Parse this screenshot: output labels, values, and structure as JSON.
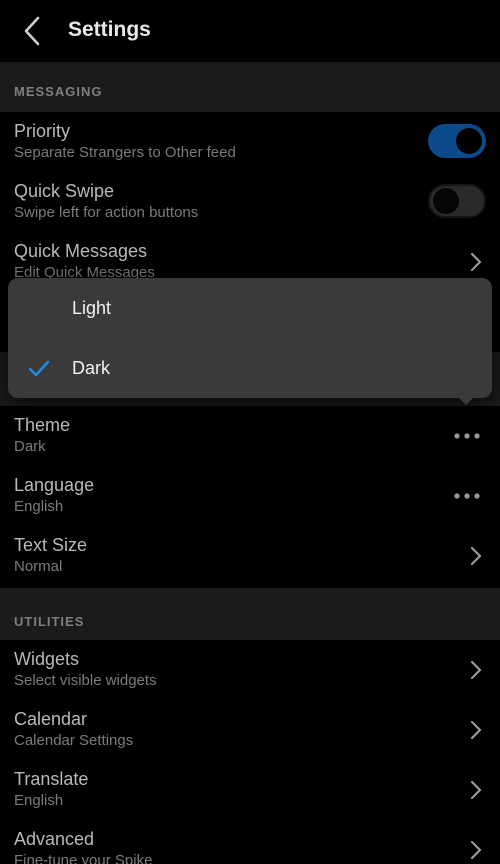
{
  "header": {
    "title": "Settings"
  },
  "sections": {
    "messaging": "MESSAGING",
    "utilities": "UTILITIES"
  },
  "messaging": {
    "priority": {
      "title": "Priority",
      "subtitle": "Separate Strangers to Other feed",
      "enabled": true
    },
    "quick_swipe": {
      "title": "Quick Swipe",
      "subtitle": "Swipe left for action buttons",
      "enabled": false
    },
    "quick_messages": {
      "title": "Quick Messages",
      "subtitle": "Edit Quick Messages"
    }
  },
  "appearance": {
    "theme": {
      "title": "Theme",
      "value": "Dark"
    },
    "language": {
      "title": "Language",
      "value": "English"
    },
    "text_size": {
      "title": "Text Size",
      "value": "Normal"
    }
  },
  "utilities": {
    "widgets": {
      "title": "Widgets",
      "subtitle": "Select visible widgets"
    },
    "calendar": {
      "title": "Calendar",
      "subtitle": "Calendar Settings"
    },
    "translate": {
      "title": "Translate",
      "subtitle": "English"
    },
    "advanced": {
      "title": "Advanced",
      "subtitle": "Fine-tune your Spike"
    }
  },
  "theme_menu": {
    "options": [
      "Light",
      "Dark"
    ],
    "selected": "Dark"
  },
  "colors": {
    "accent": "#0d4a8c",
    "check": "#1e88e5",
    "background": "#000000",
    "section": "#1b1b1b",
    "popup": "#3a3a3a"
  },
  "icons": {
    "back": "chevron-left-icon",
    "chevron": "chevron-right-icon",
    "more": "more-dots-icon",
    "check": "checkmark-icon"
  }
}
